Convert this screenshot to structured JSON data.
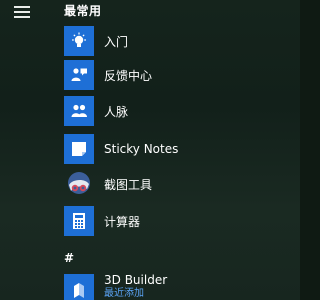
{
  "menu": {
    "section_title": "最常用",
    "group_letter": "#",
    "tile_color": "#1e6fd6",
    "items": [
      {
        "label": "入门",
        "icon": "lightbulb-icon"
      },
      {
        "label": "反馈中心",
        "icon": "feedback-hub-icon"
      },
      {
        "label": "人脉",
        "icon": "people-icon"
      },
      {
        "label": "Sticky Notes",
        "icon": "sticky-notes-icon"
      },
      {
        "label": "截图工具",
        "icon": "snipping-tool-icon"
      },
      {
        "label": "计算器",
        "icon": "calculator-icon"
      }
    ],
    "recent_app": {
      "label": "3D Builder",
      "sublabel": "最近添加",
      "icon": "3d-builder-icon"
    }
  }
}
